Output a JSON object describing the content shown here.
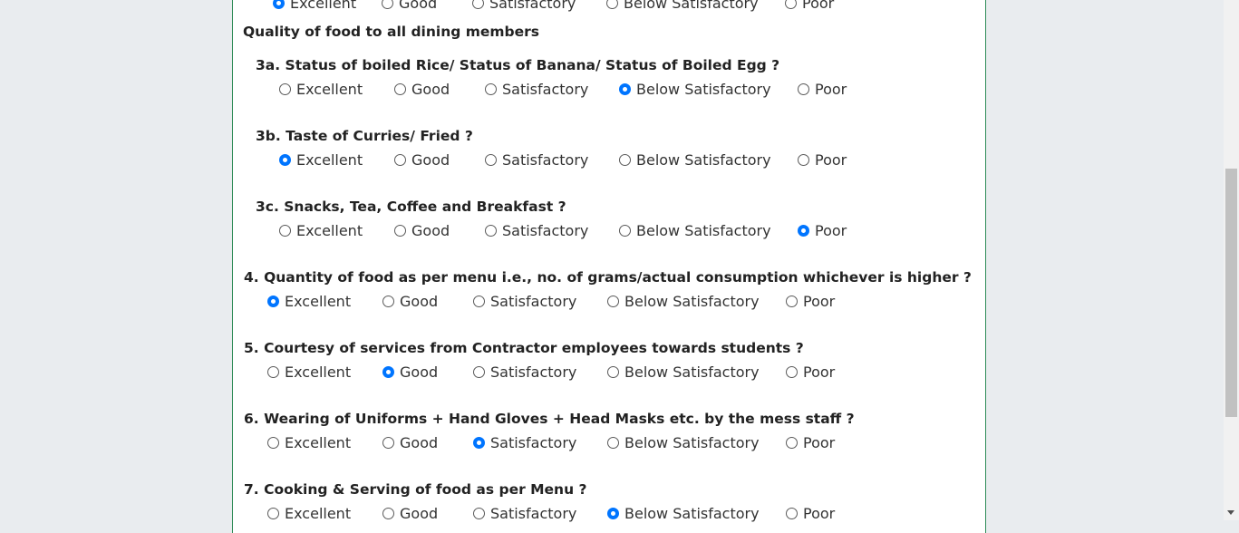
{
  "section_heading": "Quality of food to all dining members",
  "option_labels": [
    "Excellent",
    "Good",
    "Satisfactory",
    "Below Satisfactory",
    "Poor"
  ],
  "prev_question": {
    "selected": 0
  },
  "questions": [
    {
      "id": "3a",
      "title": "3a. Status of boiled Rice/ Status of Banana/ Status of Boiled Egg ?",
      "selected": 3
    },
    {
      "id": "3b",
      "title": "3b. Taste of Curries/ Fried ?",
      "selected": 0
    },
    {
      "id": "3c",
      "title": "3c. Snacks, Tea, Coffee and Breakfast ?",
      "selected": 4
    },
    {
      "id": "4",
      "title": "4. Quantity of food as per menu i.e., no. of grams/actual consumption whichever is higher ?",
      "selected": 0
    },
    {
      "id": "5",
      "title": "5. Courtesy of services from Contractor employees towards students ?",
      "selected": 1
    },
    {
      "id": "6",
      "title": "6. Wearing of Uniforms + Hand Gloves + Head Masks etc. by the mess staff ?",
      "selected": 2
    },
    {
      "id": "7",
      "title": "7. Cooking & Serving of food as per Menu ?",
      "selected": 3
    }
  ],
  "colors": {
    "accent": "#0075ff",
    "panel_border": "#2e8b57",
    "page_background": "#e9ecef"
  }
}
